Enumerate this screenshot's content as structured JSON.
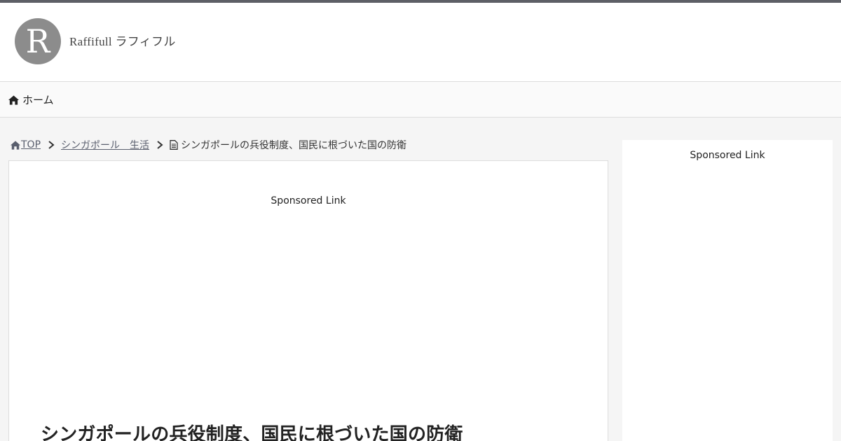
{
  "header": {
    "logo_letter": "R",
    "site_name": "Raffifull ラフィフル"
  },
  "nav": {
    "home_label": "ホーム",
    "home_icon": "home-icon"
  },
  "breadcrumb": {
    "top_label": "TOP",
    "category_label": "シンガポール　生活",
    "current_label": "シンガポールの兵役制度、国民に根づいた国の防衛"
  },
  "main": {
    "sponsored_label": "Sponsored Link",
    "title": "シンガポールの兵役制度、国民に根づいた国の防衛"
  },
  "sidebar": {
    "sponsored_label": "Sponsored Link"
  },
  "colors": {
    "topbar": "#5d5f66",
    "logo_circle": "#8c8c8c",
    "page_background": "#f5f5f5",
    "link": "#5a5f6e"
  }
}
